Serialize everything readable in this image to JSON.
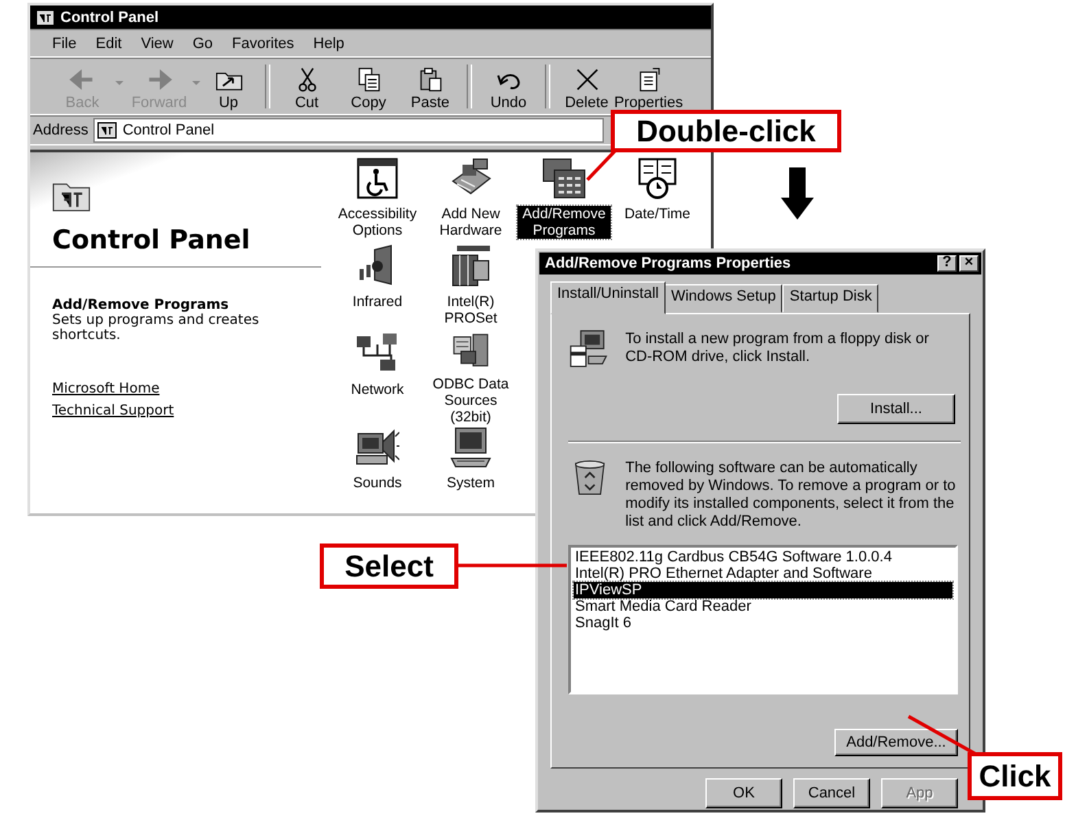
{
  "control_panel_window": {
    "title": "Control Panel",
    "menu": [
      {
        "label": "File"
      },
      {
        "label": "Edit"
      },
      {
        "label": "View"
      },
      {
        "label": "Go"
      },
      {
        "label": "Favorites"
      },
      {
        "label": "Help"
      }
    ],
    "toolbar": [
      {
        "kind": "back",
        "label": "Back",
        "disabled": true,
        "dropdown": true
      },
      {
        "kind": "forward",
        "label": "Forward",
        "disabled": true,
        "dropdown": true
      },
      {
        "kind": "up",
        "label": "Up",
        "disabled": false,
        "dropdown": false
      },
      {
        "kind": "cut",
        "label": "Cut",
        "disabled": false,
        "dropdown": false
      },
      {
        "kind": "copy",
        "label": "Copy",
        "disabled": false,
        "dropdown": false
      },
      {
        "kind": "paste",
        "label": "Paste",
        "disabled": false,
        "dropdown": false
      },
      {
        "kind": "undo",
        "label": "Undo",
        "disabled": false,
        "dropdown": false
      },
      {
        "kind": "delete",
        "label": "Delete",
        "disabled": false,
        "dropdown": false
      },
      {
        "kind": "properties",
        "label": "Properties",
        "disabled": false,
        "dropdown": false
      }
    ],
    "address": {
      "label": "Address",
      "value": "Control Panel"
    },
    "sidebar": {
      "heading": "Control Panel",
      "item_title": "Add/Remove Programs",
      "item_description": "Sets up programs and creates shortcuts.",
      "links": [
        "Microsoft Home",
        "Technical Support"
      ]
    },
    "icon_rows": [
      [
        {
          "kind": "accessibility",
          "label": "Accessibility Options",
          "selected": false
        },
        {
          "kind": "hardware",
          "label": "Add New Hardware",
          "selected": false
        },
        {
          "kind": "addremove",
          "label": "Add/Remove Programs",
          "selected": true
        },
        {
          "kind": "datetime",
          "label": "Date/Time",
          "selected": false
        }
      ],
      [
        {
          "kind": "infrared",
          "label": "Infrared",
          "selected": false
        },
        {
          "kind": "intel",
          "label": "Intel(R) PROSet",
          "selected": false
        }
      ],
      [
        {
          "kind": "network",
          "label": "Network",
          "selected": false
        },
        {
          "kind": "odbc",
          "label": "ODBC Data Sources (32bit)",
          "selected": false
        }
      ],
      [
        {
          "kind": "sounds",
          "label": "Sounds",
          "selected": false
        },
        {
          "kind": "system",
          "label": "System",
          "selected": false
        }
      ]
    ]
  },
  "dialog": {
    "title": "Add/Remove Programs Properties",
    "help_button": "?",
    "close_button": "×",
    "tabs": [
      {
        "label": "Install/Uninstall",
        "selected": true
      },
      {
        "label": "Windows Setup",
        "selected": false
      },
      {
        "label": "Startup Disk",
        "selected": false
      }
    ],
    "install_text": "To install a new program from a floppy disk or CD-ROM drive, click Install.",
    "install_button": "Install...",
    "remove_text": "The following software can be automatically removed by Windows. To remove a program or to modify its installed components, select it from the list and click Add/Remove.",
    "programs": [
      {
        "label": "IEEE802.11g Cardbus CB54G Software 1.0.0.4",
        "selected": false
      },
      {
        "label": "Intel(R) PRO Ethernet Adapter and Software",
        "selected": false
      },
      {
        "label": "IPViewSP",
        "selected": true
      },
      {
        "label": "Smart Media Card Reader",
        "selected": false
      },
      {
        "label": "SnagIt 6",
        "selected": false
      }
    ],
    "add_remove_button": "Add/Remove...",
    "buttons": [
      {
        "label": "OK",
        "disabled": false
      },
      {
        "label": "Cancel",
        "disabled": false
      },
      {
        "label": "App",
        "disabled": true
      }
    ]
  },
  "callouts": [
    {
      "label": "Double-click"
    },
    {
      "label": "Select"
    },
    {
      "label": "Click"
    }
  ]
}
